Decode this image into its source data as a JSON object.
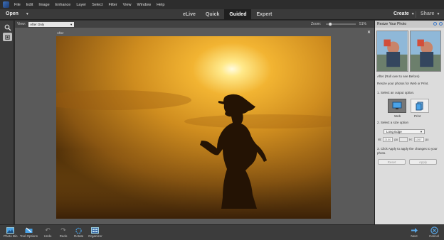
{
  "menu": [
    "File",
    "Edit",
    "Image",
    "Enhance",
    "Layer",
    "Select",
    "Filter",
    "View",
    "Window",
    "Help"
  ],
  "modebar": {
    "open_label": "Open",
    "tabs": [
      "eLive",
      "Quick",
      "Guided",
      "Expert"
    ],
    "active_tab": "Guided",
    "create_label": "Create",
    "share_label": "Share"
  },
  "options": {
    "view_label": "View:",
    "view_value": "After Only",
    "zoom_label": "Zoom:",
    "zoom_value": "51%",
    "zoom_level": 0.51
  },
  "canvas": {
    "after_label": "After"
  },
  "panel": {
    "title": "Resize Your Photo",
    "caption": "After (Roll over to see Before)",
    "intro": "Resize your photos for Web or Print.",
    "step1": "1. Select an output option.",
    "web_label": "Web",
    "print_label": "Print",
    "step2": "2. Select a size option",
    "size_value": "Long Edge",
    "w_label": "W:",
    "w_value": "2100",
    "w_unit": "px",
    "h_label": "H:",
    "h_value": "1397",
    "h_unit": "px",
    "step3": "3. Click Apply to apply the changes to your photo.",
    "reset_label": "Reset",
    "apply_label": "Apply"
  },
  "bottom": {
    "photo_bin": "Photo Bin",
    "tool_options": "Tool Options",
    "undo": "Undo",
    "redo": "Redo",
    "rotate": "Rotate",
    "organizer": "Organizer",
    "next": "Next",
    "cancel": "Cancel"
  },
  "colors": {
    "accent": "#3b78c8",
    "photo_sky": "#d99420",
    "photo_dark": "#2a1606"
  }
}
